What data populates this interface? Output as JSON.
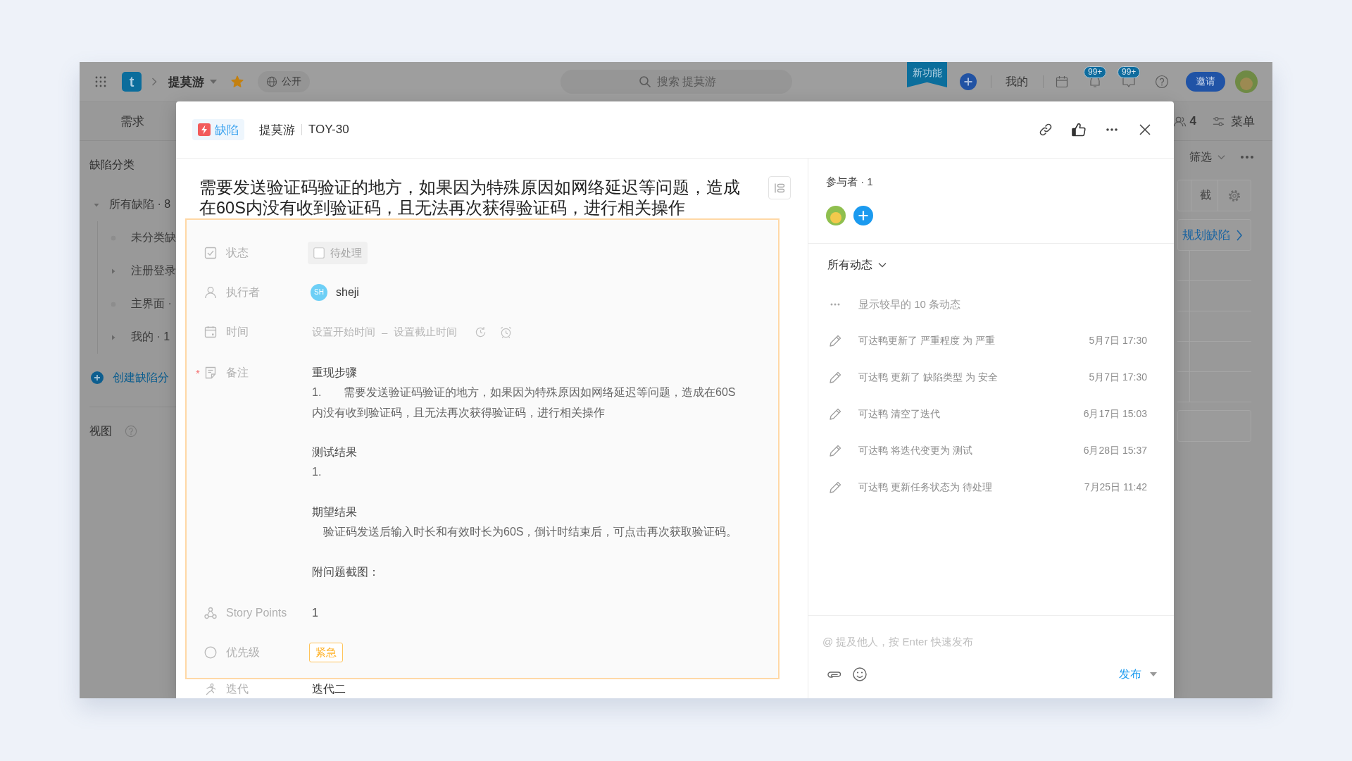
{
  "top_bar": {
    "logo_text": "t",
    "project": "提莫游",
    "starred": true,
    "visibility": "公开",
    "search_placeholder": "搜索 提莫游",
    "new_feature": "新功能",
    "my_link": "我的",
    "badges": [
      "99+",
      "99+"
    ],
    "invite_button": "邀请"
  },
  "nav_bar": {
    "tabs": [
      {
        "label": "需求",
        "selected": false
      }
    ],
    "members_count": "4",
    "menu_label": "菜单"
  },
  "sidebar": {
    "title": "缺陷分类",
    "tree": [
      {
        "label": "所有缺陷 · 8",
        "kind": "group",
        "expanded": true,
        "children": [
          {
            "label": "未分类缺",
            "kind": "leaf",
            "expanded": false
          },
          {
            "label": "注册登录",
            "kind": "group",
            "expanded": false
          },
          {
            "label": "主界面 ·",
            "kind": "leaf",
            "expanded": false
          },
          {
            "label": "我的 · 1",
            "kind": "group",
            "expanded": false
          }
        ]
      }
    ],
    "create_link": "创建缺陷分",
    "views_title": "视图"
  },
  "board": {
    "filter_label": "筛选",
    "column_header": "截",
    "plan_link": "规划缺陷"
  },
  "dialog": {
    "type_tag": "缺陷",
    "project": "提莫游",
    "key": "TOY-30",
    "title": "需要发送验证码验证的地方，如果因为特殊原因如网络延迟等问题，造成在60S内没有收到验证码，且无法再次获得验证码，进行相关操作",
    "fields": [
      {
        "kind": "status",
        "label": "状态",
        "value": "待处理",
        "checked": false
      },
      {
        "kind": "assignee",
        "label": "执行者",
        "initials": "SH",
        "value": "sheji"
      },
      {
        "kind": "time",
        "label": "时间",
        "start_placeholder": "设置开始时间",
        "separator": "–",
        "end_placeholder": "设置截止时间"
      },
      {
        "kind": "note",
        "label": "备注",
        "required_mark": "*",
        "sections": [
          {
            "heading": "重现步骤",
            "paragraphs": [
              "1.\t需要发送验证码验证的地方，如果因为特殊原因如网络延迟等问题，造成在60S内没有收到验证码，且无法再次获得验证码，进行相关操作"
            ]
          },
          {
            "heading": "测试结果",
            "paragraphs": [
              "1."
            ]
          },
          {
            "heading": "期望结果",
            "paragraphs": [
              "　验证码发送后输入时长和有效时长为60S，倒计时结束后，可点击再次获取验证码。"
            ]
          },
          {
            "heading": "附问题截图："
          }
        ]
      },
      {
        "kind": "number",
        "label": "Story Points",
        "value": "1"
      },
      {
        "kind": "priority",
        "label": "优先级",
        "value": "紧急"
      },
      {
        "kind": "text",
        "label": "迭代",
        "value": "迭代二"
      }
    ],
    "participants_label": "参与者 · 1",
    "activity": {
      "filter_label": "所有动态",
      "show_earlier": "显示较早的 10 条动态",
      "items": [
        {
          "text": "可达鸭更新了 严重程度 为 严重",
          "time": "5月7日 17:30"
        },
        {
          "text": "可达鸭 更新了 缺陷类型 为 安全",
          "time": "5月7日 17:30"
        },
        {
          "text": "可达鸭 清空了迭代",
          "time": "6月17日 15:03"
        },
        {
          "text": "可达鸭 将迭代变更为 测试",
          "time": "6月28日 15:37"
        },
        {
          "text": "可达鸭 更新任务状态为 待处理",
          "time": "7月25日 11:42"
        }
      ]
    },
    "comment": {
      "placeholder": "@ 提及他人，按 Enter 快速发布",
      "submit_button": "发布"
    }
  }
}
